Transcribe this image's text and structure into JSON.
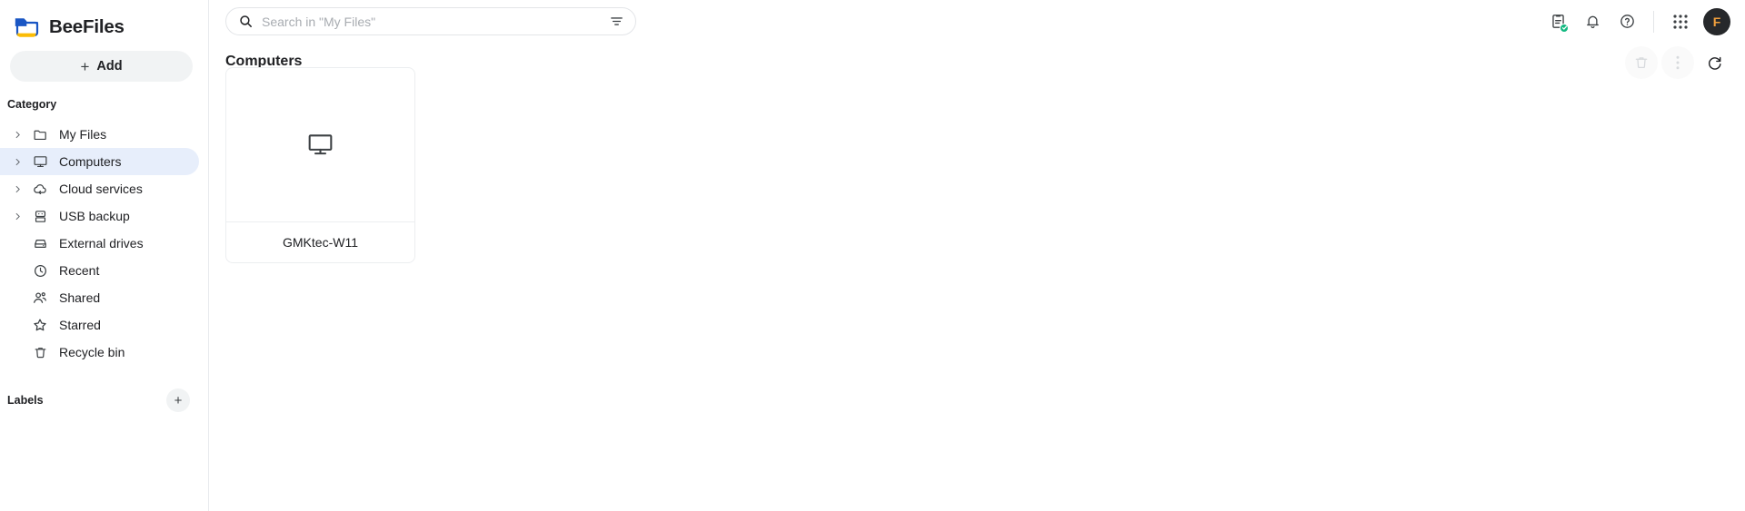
{
  "app": {
    "name": "BeeFiles",
    "logo_icon": "folder-logo-icon",
    "logo_colors": {
      "blue": "#1a56c4",
      "yellow": "#fbbc05"
    }
  },
  "sidebar": {
    "add_button": {
      "label": "Add",
      "icon": "plus-icon"
    },
    "category_title": "Category",
    "items": [
      {
        "label": "My Files",
        "icon": "folder-icon",
        "expandable": true,
        "active": false
      },
      {
        "label": "Computers",
        "icon": "monitor-icon",
        "expandable": true,
        "active": true
      },
      {
        "label": "Cloud services",
        "icon": "cloud-sync-icon",
        "expandable": true,
        "active": false
      },
      {
        "label": "USB backup",
        "icon": "usb-drive-icon",
        "expandable": true,
        "active": false
      },
      {
        "label": "External drives",
        "icon": "hard-drive-icon",
        "expandable": false,
        "active": false
      },
      {
        "label": "Recent",
        "icon": "clock-icon",
        "expandable": false,
        "active": false
      },
      {
        "label": "Shared",
        "icon": "people-icon",
        "expandable": false,
        "active": false
      },
      {
        "label": "Starred",
        "icon": "star-icon",
        "expandable": false,
        "active": false
      },
      {
        "label": "Recycle bin",
        "icon": "trash-icon",
        "expandable": false,
        "active": false
      }
    ],
    "labels_title": "Labels",
    "labels_add_icon": "plus-icon",
    "active_highlight_color": "#e7eefb"
  },
  "search": {
    "placeholder": "Search in \"My Files\"",
    "value": "",
    "search_icon": "search-icon",
    "filter_icon": "filter-icon"
  },
  "top_actions": {
    "tasks": {
      "icon": "clipboard-check-icon",
      "badge_color": "#13b981"
    },
    "notifications": {
      "icon": "bell-icon"
    },
    "help": {
      "icon": "help-circle-icon"
    },
    "apps": {
      "icon": "grid-dots-icon"
    },
    "avatar": {
      "initial": "F",
      "bg": "#26282b",
      "fg": "#f2a03d"
    }
  },
  "content": {
    "title": "Computers",
    "actions": {
      "delete": {
        "icon": "trash-icon",
        "enabled": false
      },
      "more": {
        "icon": "more-vertical-icon",
        "enabled": false
      },
      "refresh": {
        "icon": "refresh-icon",
        "enabled": true
      }
    },
    "items": [
      {
        "name": "GMKtec-W11",
        "icon": "monitor-icon"
      }
    ]
  }
}
